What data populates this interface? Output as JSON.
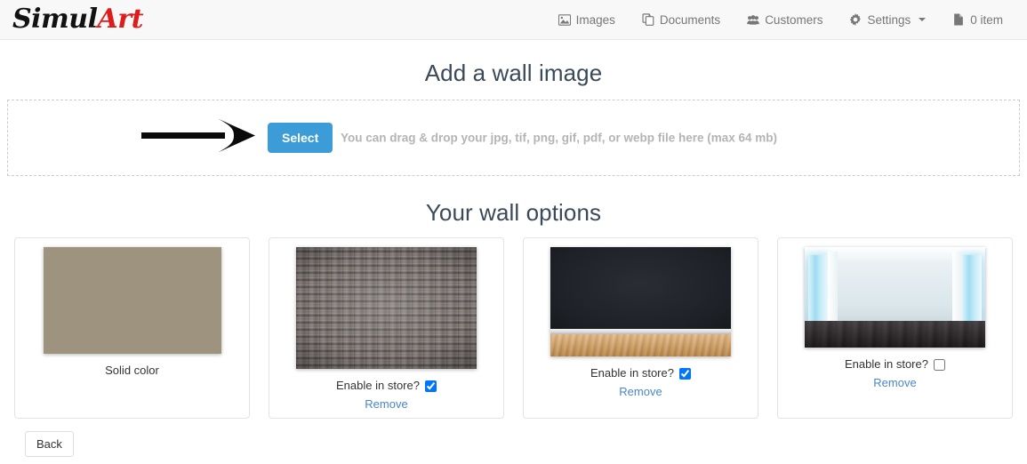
{
  "header": {
    "brand_first": "Simul",
    "brand_second": "Art",
    "nav": [
      {
        "label": "Images",
        "icon": "image-icon"
      },
      {
        "label": "Documents",
        "icon": "documents-icon"
      },
      {
        "label": "Customers",
        "icon": "customers-icon"
      },
      {
        "label": "Settings",
        "icon": "gear-icon",
        "caret": true
      },
      {
        "label": "0 item",
        "icon": "file-icon"
      }
    ]
  },
  "upload": {
    "title": "Add a wall image",
    "select_label": "Select",
    "hint": "You can drag & drop your jpg, tif, png, gif, pdf, or webp file here (max 64 mb)"
  },
  "options": {
    "title": "Your wall options",
    "enable_label": "Enable in store?",
    "remove_label": "Remove",
    "cards": [
      {
        "kind": "solid",
        "label": "Solid color",
        "color": "#9d937f",
        "has_checkbox": false,
        "has_remove": false,
        "thumb_w": 200,
        "thumb_h": 120
      },
      {
        "kind": "stone",
        "label": "",
        "has_checkbox": true,
        "checked": true,
        "has_remove": true,
        "thumb_w": 203,
        "thumb_h": 137
      },
      {
        "kind": "dark-room",
        "label": "",
        "has_checkbox": true,
        "checked": true,
        "has_remove": true,
        "thumb_w": 203,
        "thumb_h": 123
      },
      {
        "kind": "bright-room",
        "label": "",
        "has_checkbox": true,
        "checked": false,
        "has_remove": true,
        "thumb_w": 203,
        "thumb_h": 113
      }
    ]
  },
  "footer": {
    "back_label": "Back"
  },
  "colors": {
    "accent": "#3c9cd7",
    "link": "#4a86c7",
    "brand_red": "#e01b1b",
    "heading": "#3a4a58"
  }
}
